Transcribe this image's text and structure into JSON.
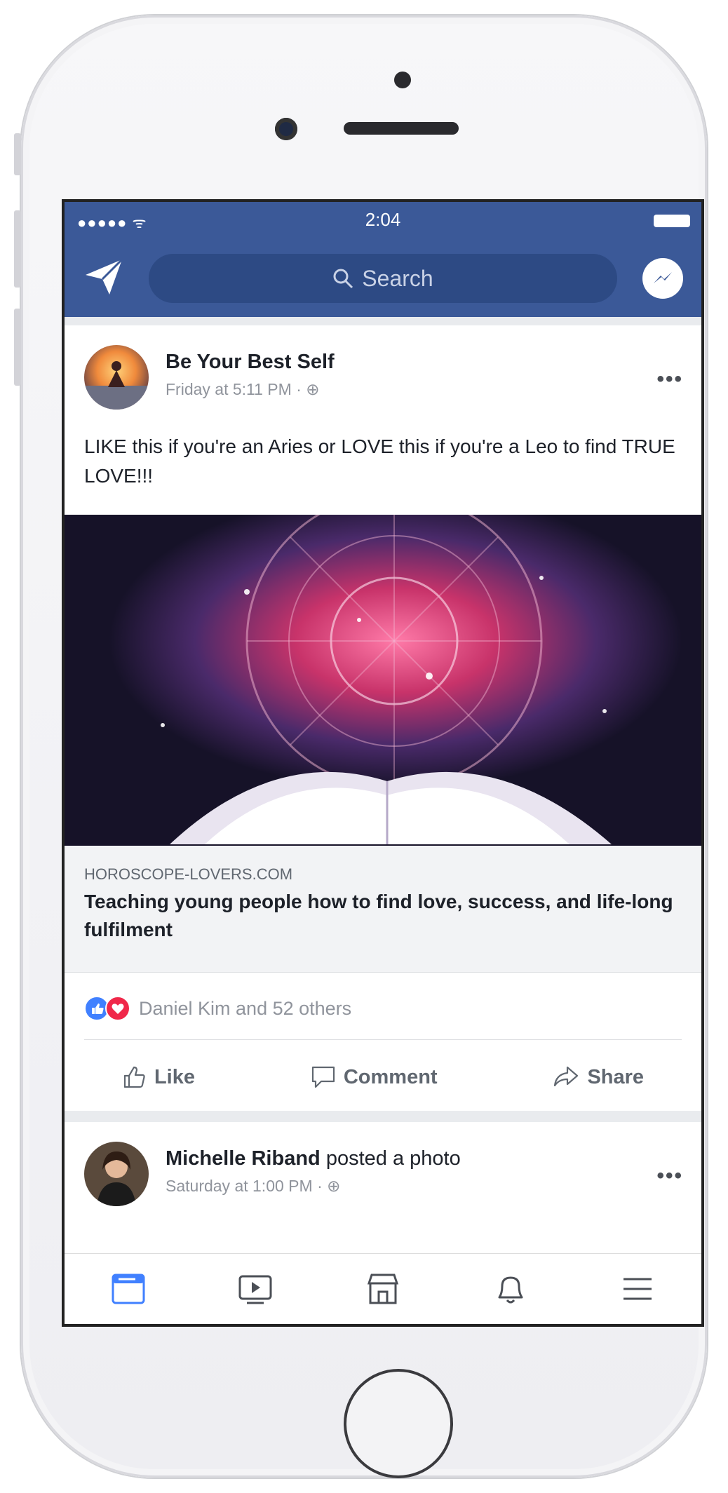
{
  "status_bar": {
    "signal": "●●●●● ᯤ",
    "time": "2:04"
  },
  "navbar": {
    "search_placeholder": "Search"
  },
  "post1": {
    "page_name": "Be Your Best Self",
    "timestamp": "Friday at 5:11 PM · ",
    "text": "LIKE this if you're an Aries or LOVE this if you're a Leo to find TRUE LOVE!!!",
    "link_domain": "HOROSCOPE-LOVERS.COM",
    "link_title": "Teaching young people how to find love, success, and life-long fulfilment",
    "reactions_text": "Daniel Kim and 52 others",
    "actions": {
      "like": "Like",
      "comment": "Comment",
      "share": "Share"
    }
  },
  "post2": {
    "author": "Michelle Riband",
    "activity": " posted a photo",
    "timestamp": "Saturday at 1:00 PM · "
  },
  "colors": {
    "brand": "#3b5998",
    "like": "#4080ff",
    "love": "#f0284a",
    "tab_active": "#4080ff",
    "tab_inactive": "#4b4f56"
  },
  "tabs": [
    "news-feed-icon",
    "watch-icon",
    "marketplace-icon",
    "notifications-icon",
    "menu-icon"
  ]
}
